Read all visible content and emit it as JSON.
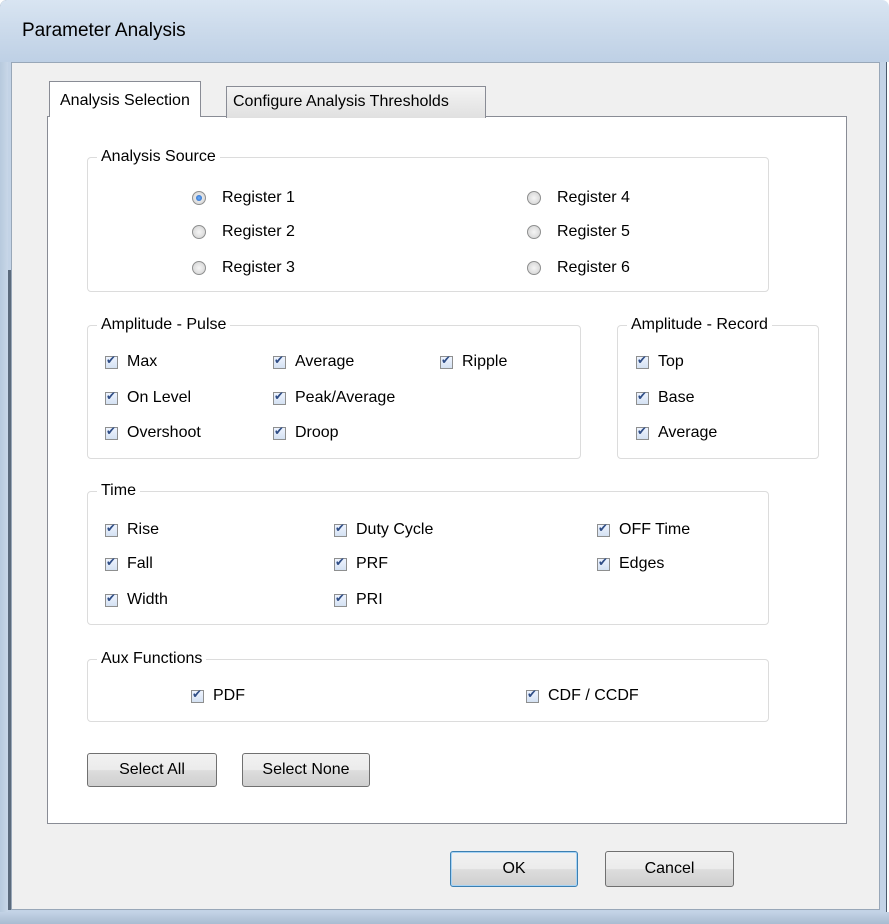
{
  "window": {
    "title": "Parameter Analysis"
  },
  "tabs": [
    {
      "label": "Analysis Selection",
      "active": true
    },
    {
      "label": "Configure Analysis Thresholds",
      "active": false
    }
  ],
  "analysis_source": {
    "legend": "Analysis Source",
    "options": [
      {
        "label": "Register 1",
        "selected": true
      },
      {
        "label": "Register 2",
        "selected": false
      },
      {
        "label": "Register 3",
        "selected": false
      },
      {
        "label": "Register 4",
        "selected": false
      },
      {
        "label": "Register 5",
        "selected": false
      },
      {
        "label": "Register 6",
        "selected": false
      }
    ]
  },
  "amplitude_pulse": {
    "legend": "Amplitude - Pulse",
    "options": [
      {
        "label": "Max",
        "checked": true
      },
      {
        "label": "On Level",
        "checked": true
      },
      {
        "label": "Overshoot",
        "checked": true
      },
      {
        "label": "Average",
        "checked": true
      },
      {
        "label": "Peak/Average",
        "checked": true
      },
      {
        "label": "Droop",
        "checked": true
      },
      {
        "label": "Ripple",
        "checked": true
      }
    ]
  },
  "amplitude_record": {
    "legend": "Amplitude - Record",
    "options": [
      {
        "label": "Top",
        "checked": true
      },
      {
        "label": "Base",
        "checked": true
      },
      {
        "label": "Average",
        "checked": true
      }
    ]
  },
  "time": {
    "legend": "Time",
    "options": [
      {
        "label": "Rise",
        "checked": true
      },
      {
        "label": "Fall",
        "checked": true
      },
      {
        "label": "Width",
        "checked": true
      },
      {
        "label": "Duty Cycle",
        "checked": true
      },
      {
        "label": "PRF",
        "checked": true
      },
      {
        "label": "PRI",
        "checked": true
      },
      {
        "label": "OFF Time",
        "checked": true
      },
      {
        "label": "Edges",
        "checked": true
      }
    ]
  },
  "aux_functions": {
    "legend": "Aux  Functions",
    "options": [
      {
        "label": "PDF",
        "checked": true
      },
      {
        "label": "CDF / CCDF",
        "checked": true
      }
    ]
  },
  "buttons": {
    "select_all": "Select All",
    "select_none": "Select None",
    "ok": "OK",
    "cancel": "Cancel"
  },
  "colors": {
    "checkmark": "#2f4d86",
    "radio_dot": "#1f5fb8",
    "frame": "#c3d3e6"
  }
}
